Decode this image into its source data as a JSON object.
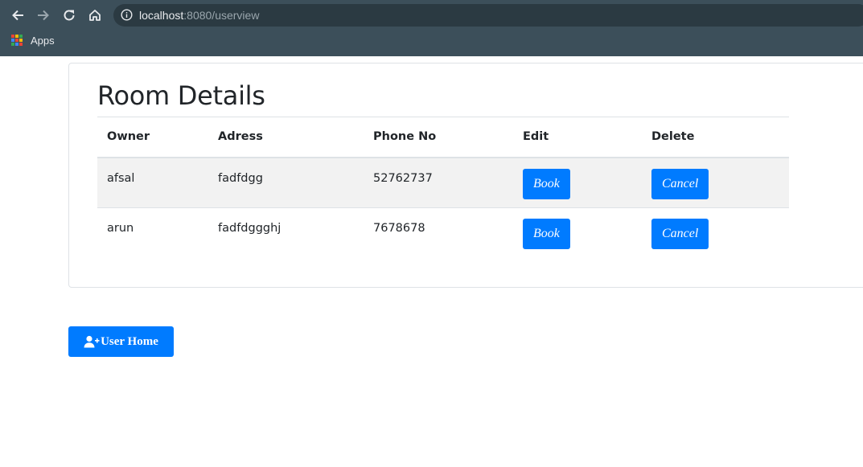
{
  "browser": {
    "url_host": "localhost",
    "url_rest": ":8080/userview",
    "bookmarks": [
      {
        "label": "Apps",
        "icon": "apps-grid-icon"
      }
    ],
    "nav_icons": [
      "back-arrow-icon",
      "forward-arrow-icon",
      "reload-icon",
      "home-icon",
      "info-icon"
    ]
  },
  "page": {
    "title": "Room Details",
    "table": {
      "headers": [
        "Owner",
        "Adress",
        "Phone No",
        "Edit",
        "Delete"
      ],
      "rows": [
        {
          "owner": "afsal",
          "adress": "fadfdgg",
          "phone": "52762737",
          "edit_label": "Book",
          "delete_label": "Cancel"
        },
        {
          "owner": "arun",
          "adress": "fadfdggghj",
          "phone": "7678678",
          "edit_label": "Book",
          "delete_label": "Cancel"
        }
      ]
    },
    "home_button": {
      "label": "User Home",
      "icon": "user-plus-icon"
    }
  },
  "colors": {
    "primary": "#007bff",
    "chrome": "#3c4f5a",
    "stripe": "#f2f2f2"
  }
}
